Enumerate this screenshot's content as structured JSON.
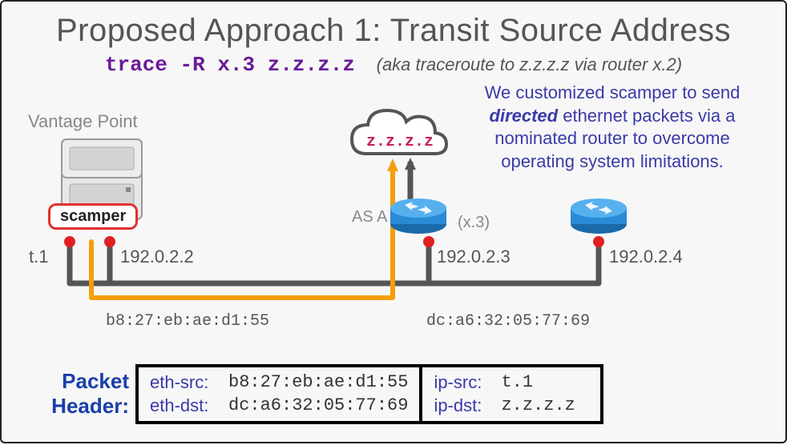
{
  "title": "Proposed Approach 1: Transit Source Address",
  "subtitle": {
    "cmd": "trace -R x.3 z.z.z.z",
    "explain": "(aka traceroute to z.z.z.z via router x.2)"
  },
  "explain": {
    "l1": "We customized scamper to send",
    "l2a": "directed",
    "l2b": " ethernet packets via a",
    "l3": "nominated router to overcome",
    "l4": "operating system limitations."
  },
  "vp_label": "Vantage Point",
  "scamper_label": "scamper",
  "cloud_label": "z.z.z.z",
  "asa_label": "AS A",
  "x3_label": "(x.3)",
  "iface": {
    "t1": {
      "ip": "t.1"
    },
    "src": {
      "ip": "192.0.2.2",
      "mac": "b8:27:eb:ae:d1:55"
    },
    "r1": {
      "ip": "192.0.2.3",
      "mac": "dc:a6:32:05:77:69"
    },
    "r2": {
      "ip": "192.0.2.4"
    }
  },
  "packet": {
    "title1": "Packet",
    "title2": "Header:",
    "eth_src_k": "eth-src:",
    "eth_src_v": "b8:27:eb:ae:d1:55",
    "eth_dst_k": "eth-dst:",
    "eth_dst_v": "dc:a6:32:05:77:69",
    "ip_src_k": "ip-src:",
    "ip_src_v": "t.1",
    "ip_dst_k": "ip-dst:",
    "ip_dst_v": "z.z.z.z"
  }
}
